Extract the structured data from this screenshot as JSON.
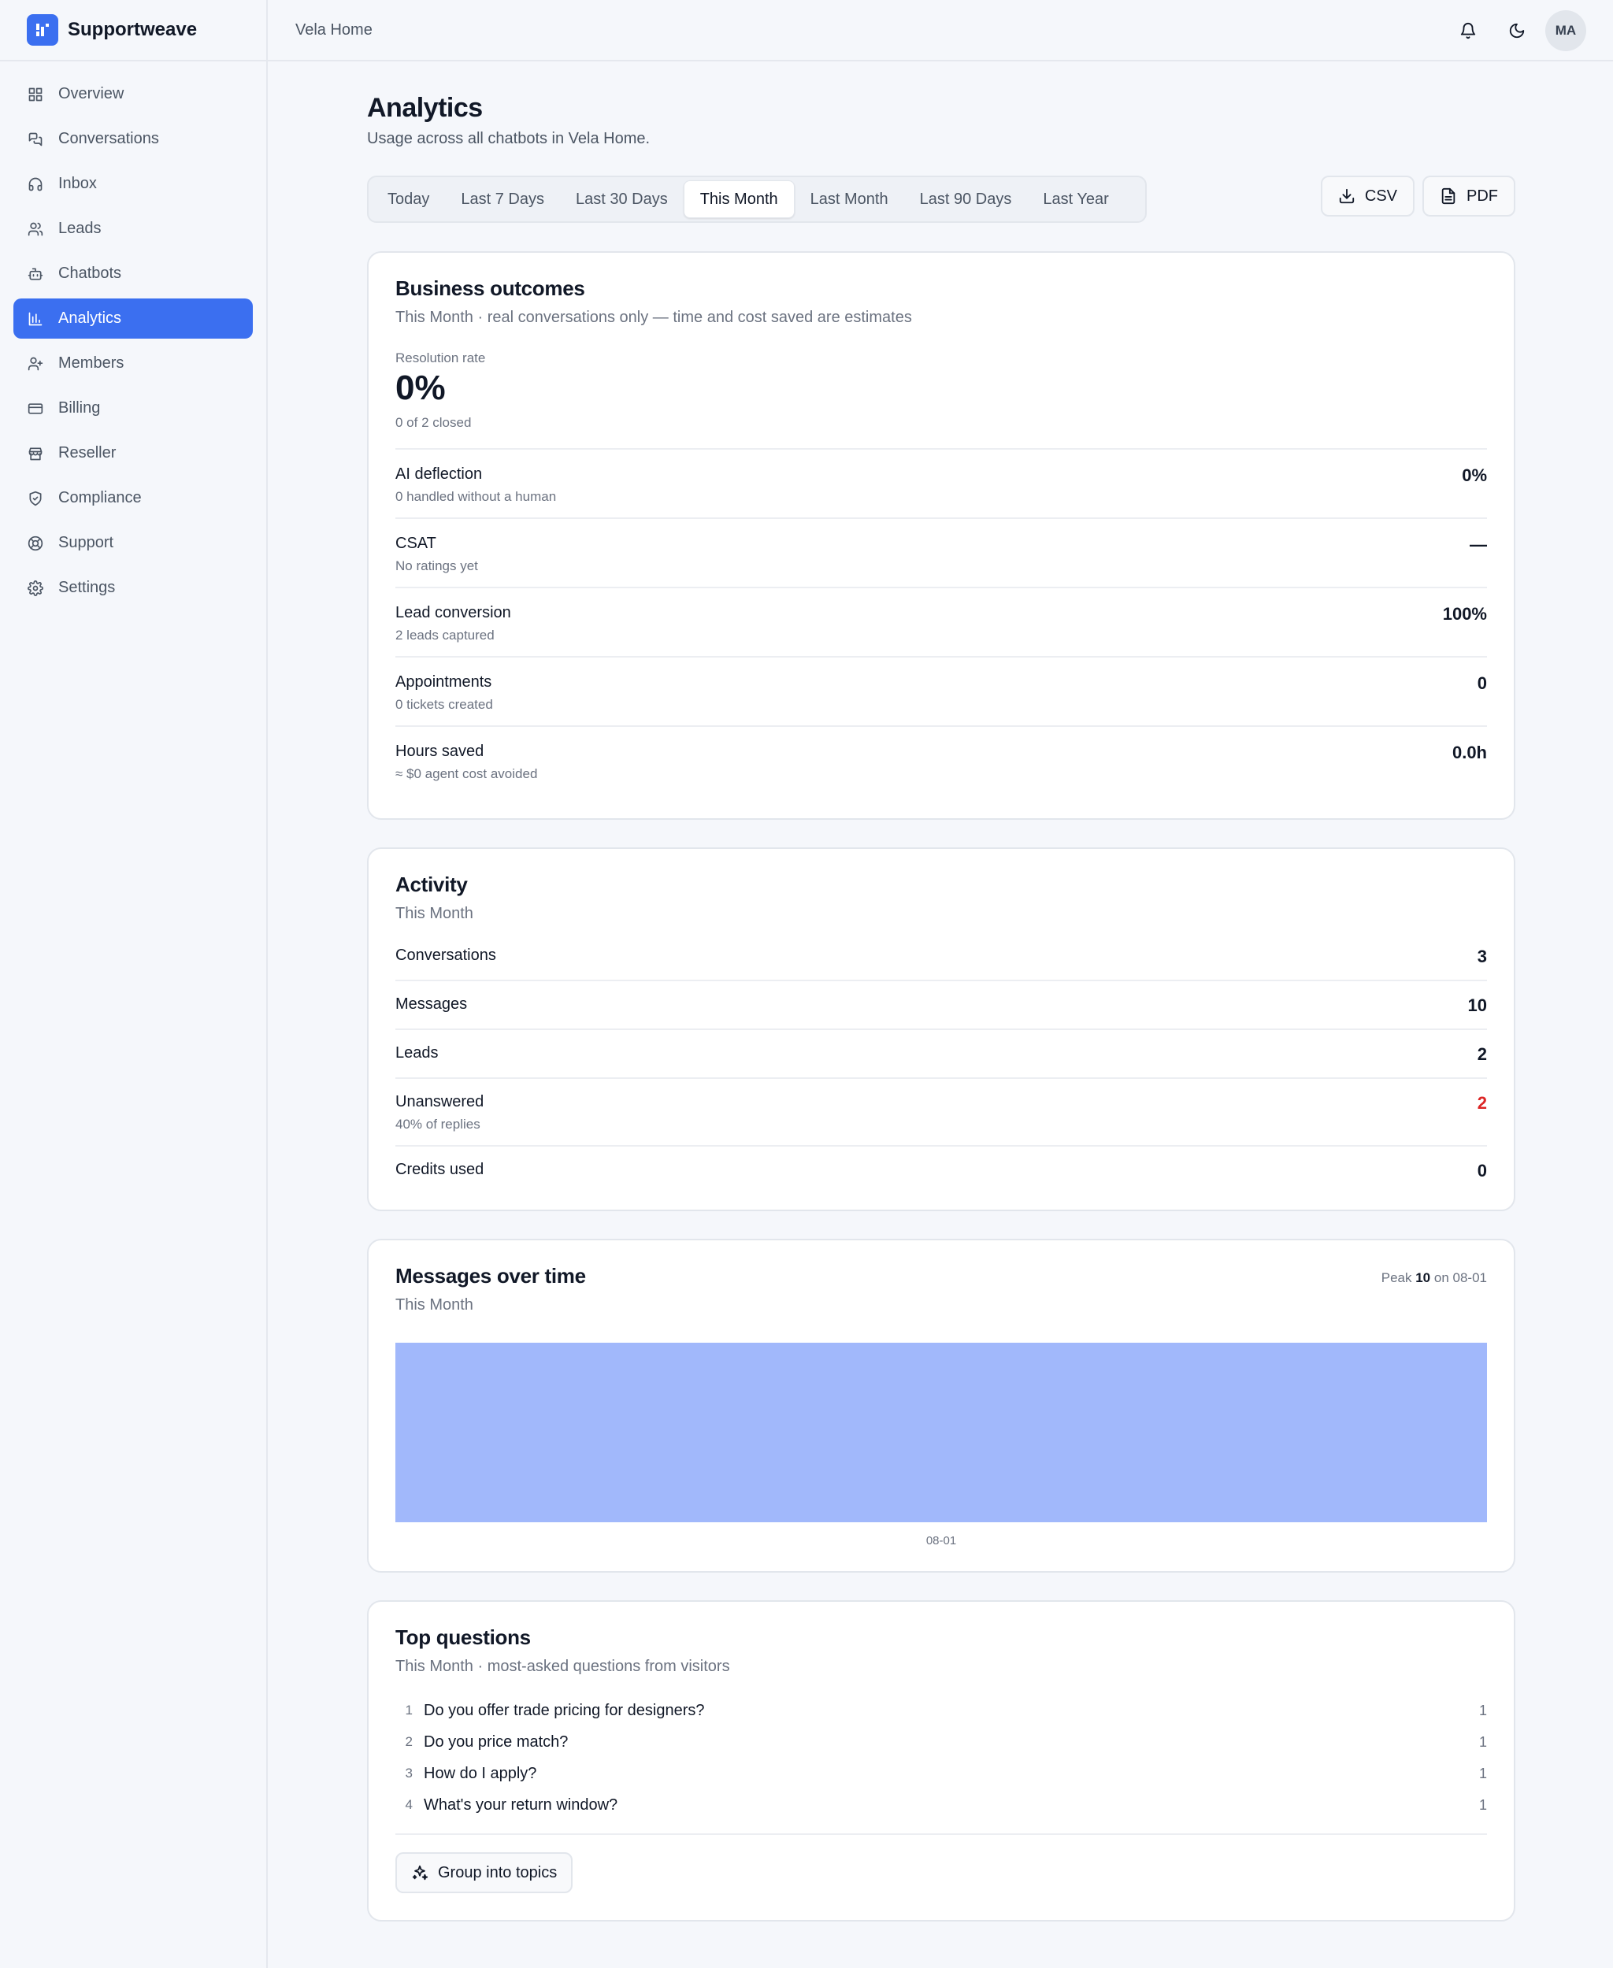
{
  "app": {
    "brand": "Supportweave",
    "workspace": "Vela Home",
    "avatar_initials": "MA",
    "accent_color": "#3b6ff0"
  },
  "sidebar": {
    "items": [
      {
        "label": "Overview",
        "icon": "grid-icon"
      },
      {
        "label": "Conversations",
        "icon": "chat-icon"
      },
      {
        "label": "Inbox",
        "icon": "headset-icon"
      },
      {
        "label": "Leads",
        "icon": "users-icon"
      },
      {
        "label": "Chatbots",
        "icon": "bot-icon"
      },
      {
        "label": "Analytics",
        "icon": "bar-chart-icon",
        "active": true
      },
      {
        "label": "Members",
        "icon": "user-plus-icon"
      },
      {
        "label": "Billing",
        "icon": "credit-card-icon"
      },
      {
        "label": "Reseller",
        "icon": "store-icon"
      },
      {
        "label": "Compliance",
        "icon": "shield-check-icon"
      },
      {
        "label": "Support",
        "icon": "lifebuoy-icon"
      },
      {
        "label": "Settings",
        "icon": "gear-icon"
      }
    ]
  },
  "page": {
    "title": "Analytics",
    "subtitle": "Usage across all chatbots in Vela Home."
  },
  "ranges": {
    "tabs": [
      "Today",
      "Last 7 Days",
      "Last 30 Days",
      "This Month",
      "Last Month",
      "Last 90 Days",
      "Last Year"
    ],
    "selected": "This Month"
  },
  "exports": {
    "csv": "CSV",
    "pdf": "PDF"
  },
  "outcomes": {
    "title": "Business outcomes",
    "subtitle": "This Month · real conversations only — time and cost saved are estimates",
    "resolution": {
      "label": "Resolution rate",
      "value": "0%",
      "sub": "0 of 2 closed"
    },
    "rows": [
      {
        "label": "AI deflection",
        "sub": "0 handled without a human",
        "value": "0%"
      },
      {
        "label": "CSAT",
        "sub": "No ratings yet",
        "value": "—"
      },
      {
        "label": "Lead conversion",
        "sub": "2 leads captured",
        "value": "100%"
      },
      {
        "label": "Appointments",
        "sub": "0 tickets created",
        "value": "0"
      },
      {
        "label": "Hours saved",
        "sub": "≈ $0 agent cost avoided",
        "value": "0.0h"
      }
    ]
  },
  "activity": {
    "title": "Activity",
    "subtitle": "This Month",
    "rows": [
      {
        "label": "Conversations",
        "value": "3"
      },
      {
        "label": "Messages",
        "value": "10"
      },
      {
        "label": "Leads",
        "value": "2"
      },
      {
        "label": "Unanswered",
        "sub": "40% of replies",
        "value": "2",
        "warn": true
      },
      {
        "label": "Credits used",
        "value": "0"
      }
    ]
  },
  "messages_chart": {
    "title": "Messages over time",
    "subtitle": "This Month",
    "peak_prefix": "Peak",
    "peak_value": "10",
    "peak_suffix": "on 08-01",
    "bar_color": "#a1b8fb"
  },
  "chart_data": {
    "type": "area",
    "x": [
      "08-01"
    ],
    "values": [
      10
    ],
    "ylim": [
      0,
      10
    ],
    "grid": false
  },
  "questions": {
    "title": "Top questions",
    "subtitle": "This Month · most-asked questions from visitors",
    "items": [
      {
        "num": "1",
        "text": "Do you offer trade pricing for designers?",
        "count": "1"
      },
      {
        "num": "2",
        "text": "Do you price match?",
        "count": "1"
      },
      {
        "num": "3",
        "text": "How do I apply?",
        "count": "1"
      },
      {
        "num": "4",
        "text": "What's your return window?",
        "count": "1"
      }
    ],
    "group_button": "Group into topics"
  }
}
